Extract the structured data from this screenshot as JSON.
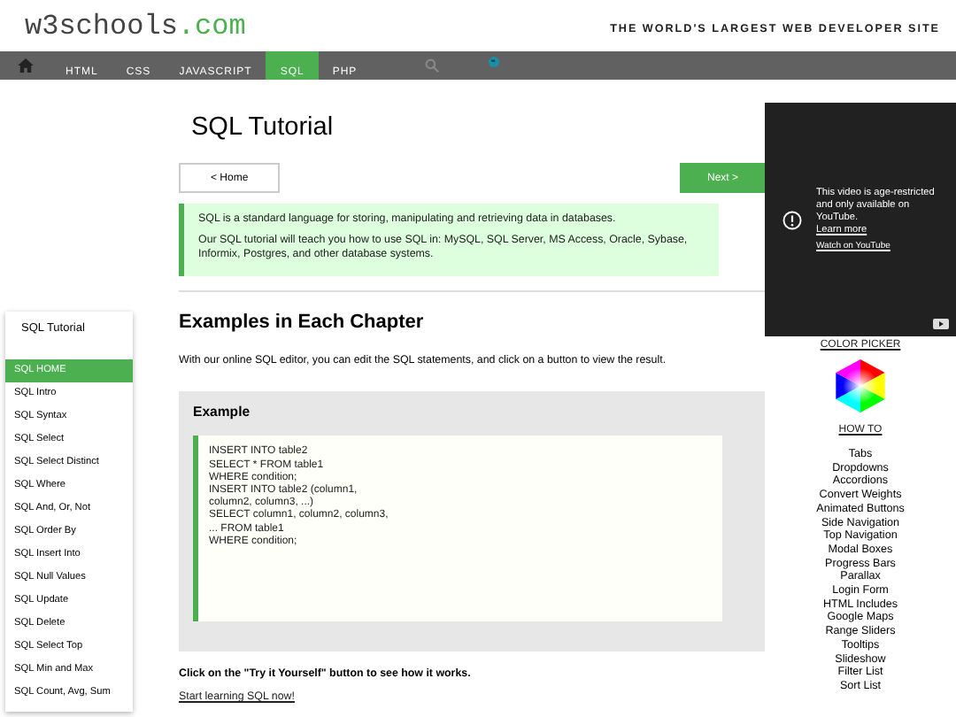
{
  "header": {
    "logo_main": "w3schools",
    "logo_suffix": ".com",
    "tagline": "THE WORLD'S LARGEST WEB DEVELOPER SITE"
  },
  "nav": {
    "items": [
      {
        "label": "HTML",
        "selected": false
      },
      {
        "label": "CSS",
        "selected": false
      },
      {
        "label": "JAVASCRIPT",
        "selected": false
      },
      {
        "label": "SQL",
        "selected": true
      },
      {
        "label": "PHP",
        "selected": false
      }
    ]
  },
  "sidebar": {
    "title": "SQL Tutorial",
    "items": [
      {
        "label": "SQL HOME",
        "selected": true
      },
      {
        "label": "SQL Intro",
        "selected": false
      },
      {
        "label": "SQL Syntax",
        "selected": false
      },
      {
        "label": "SQL Select",
        "selected": false
      },
      {
        "label": "SQL Select Distinct",
        "selected": false
      },
      {
        "label": "SQL Where",
        "selected": false
      },
      {
        "label": "SQL And, Or, Not",
        "selected": false
      },
      {
        "label": "SQL Order By",
        "selected": false
      },
      {
        "label": "SQL Insert Into",
        "selected": false
      },
      {
        "label": "SQL Null Values",
        "selected": false
      },
      {
        "label": "SQL Update",
        "selected": false
      },
      {
        "label": "SQL Delete",
        "selected": false
      },
      {
        "label": "SQL Select Top",
        "selected": false
      },
      {
        "label": "SQL Min and Max",
        "selected": false
      },
      {
        "label": "SQL Count, Avg, Sum",
        "selected": false
      }
    ]
  },
  "main": {
    "title": "SQL Tutorial",
    "prev_button": "< Home",
    "next_button": "Next >",
    "note": [
      "SQL is a standard language for storing, manipulating and retrieving data in databases.",
      "Our SQL tutorial will teach you how to use SQL in: MySQL, SQL Server, MS Access, Oracle, Sybase, Informix, Postgres, and other database systems."
    ],
    "section_heading": "Examples in Each Chapter",
    "intro": "With our online SQL editor, you can edit the SQL statements, and click on a button to view the result.",
    "example": {
      "title": "Example",
      "code": [
        "INSERT INTO table2",
        "SELECT * FROM table1",
        "WHERE condition;",
        "INSERT INTO table2 (column1,",
        "column2, column3, ...)",
        "SELECT column1, column2, column3,",
        "... FROM table1",
        "WHERE condition;"
      ]
    },
    "tip": "Click on the \"Try it Yourself\" button to see how it works.",
    "link": "Start learning SQL now!"
  },
  "right": {
    "video": {
      "message": "This video is age-restricted and only available on YouTube.",
      "learn_more": "Learn more",
      "watch_link": "Watch on YouTube"
    },
    "color_picker_link": "COLOR PICKER",
    "howto_title": "HOW TO",
    "howto_links": [
      "Tabs",
      "Dropdowns",
      "Accordions",
      "Convert Weights",
      "Animated Buttons",
      "Side Navigation",
      "Top Navigation",
      "Modal Boxes",
      "Progress Bars",
      "Parallax",
      "Login Form",
      "HTML Includes",
      "Google Maps",
      "Range Sliders",
      "Tooltips",
      "Slideshow",
      "Filter List",
      "Sort List"
    ]
  }
}
